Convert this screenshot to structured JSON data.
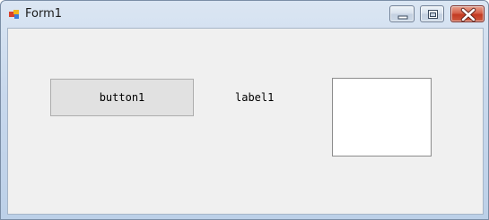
{
  "window": {
    "title": "Form1",
    "app_icon": "winforms-app-icon",
    "controls": {
      "minimize_icon": "minimize-icon",
      "maximize_icon": "maximize-icon",
      "close_icon": "close-icon",
      "close_color": "#c8452b"
    }
  },
  "form": {
    "background": "#f0f0f0",
    "button1": {
      "label": "button1"
    },
    "label1": {
      "text": "label1"
    },
    "picture_box": {
      "background": "#ffffff"
    }
  }
}
